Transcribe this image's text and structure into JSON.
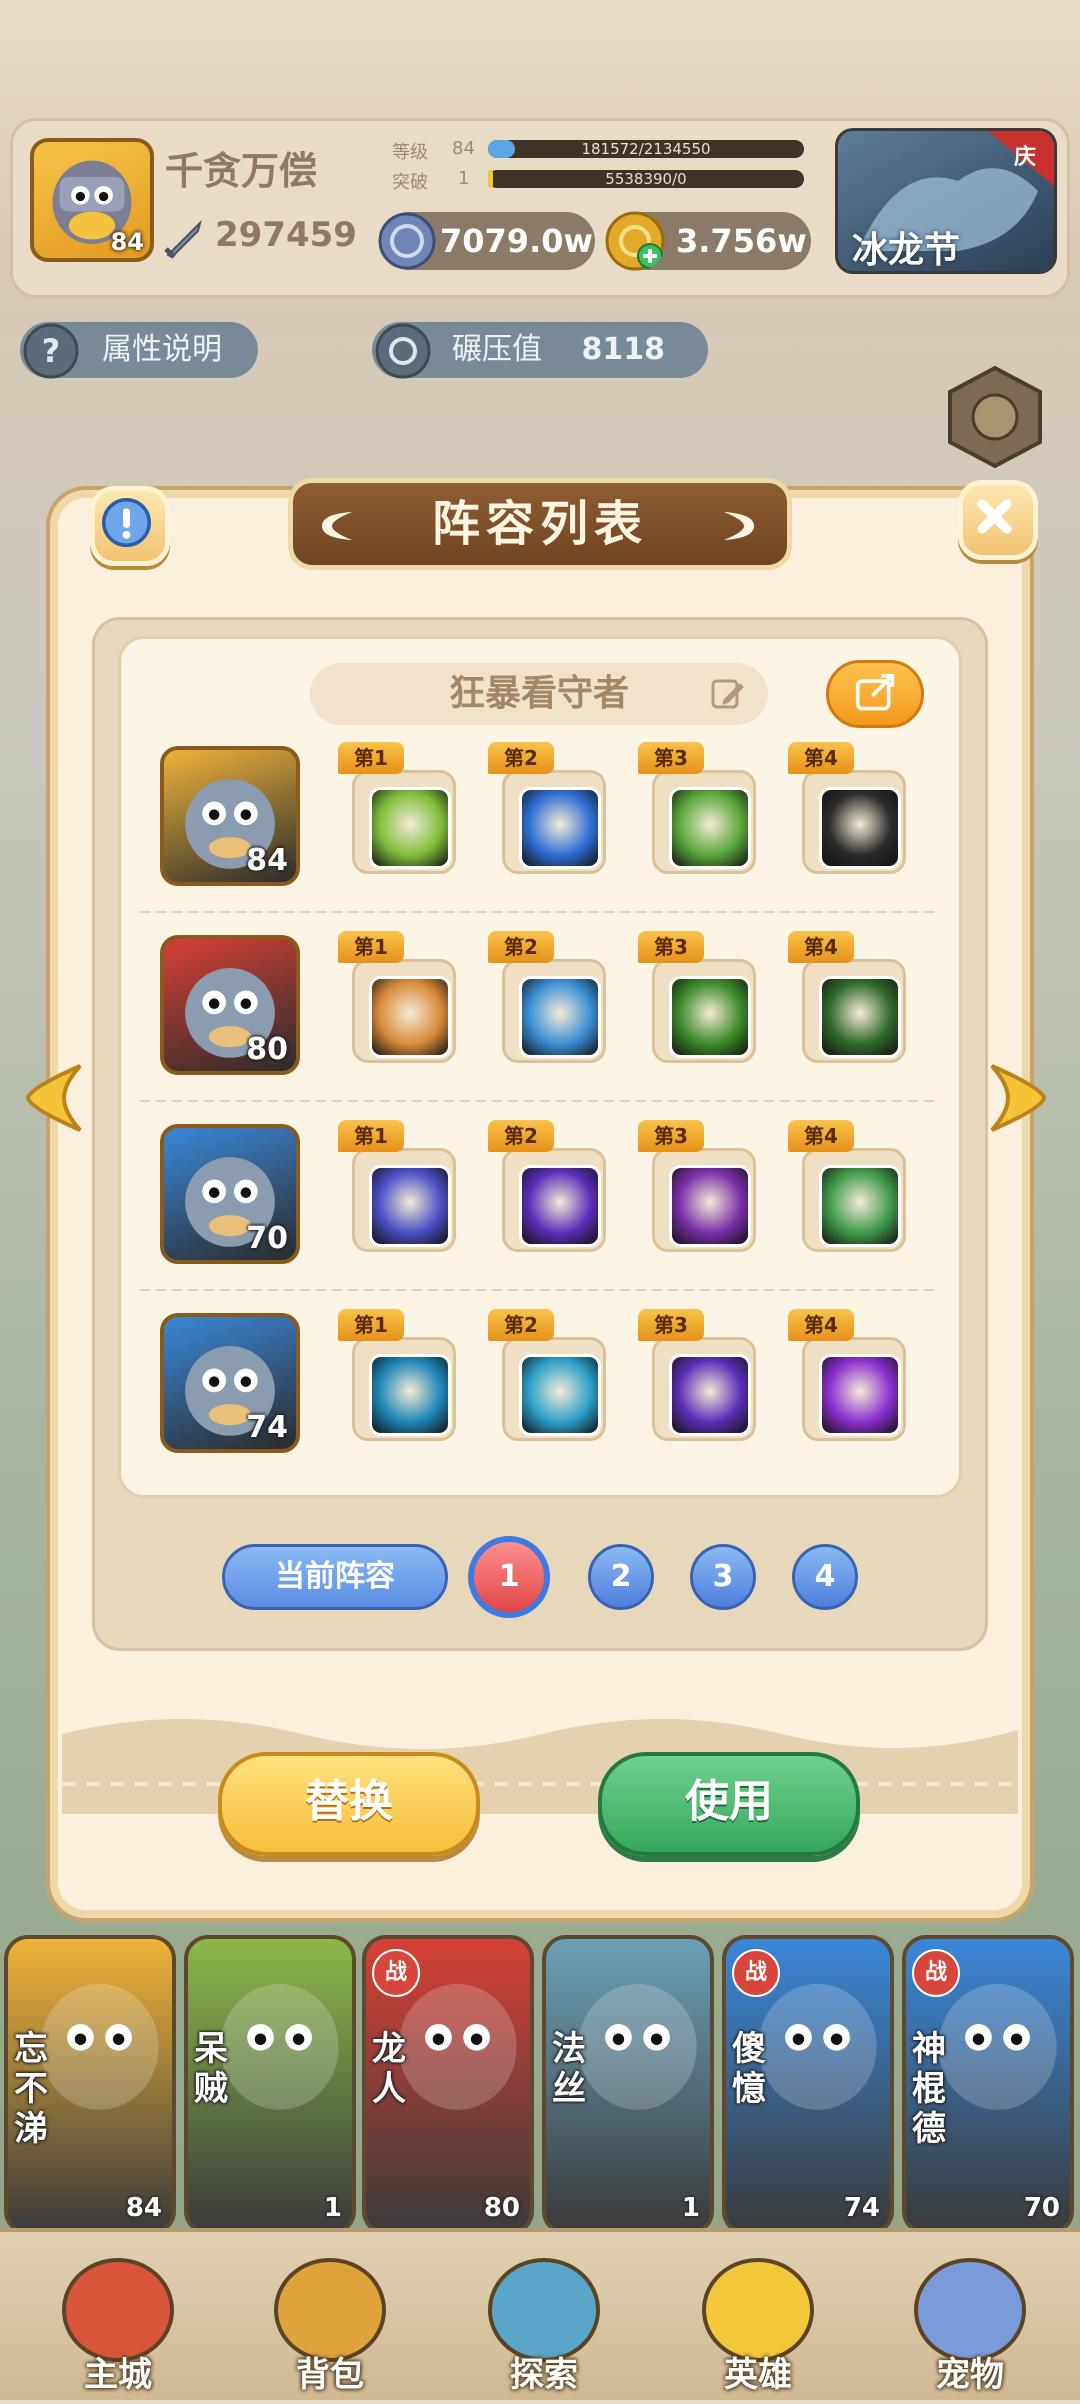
{
  "player": {
    "name": "千贪万偿",
    "avatar_level": "84",
    "power": "297459",
    "level_label": "等级",
    "level_value": "84",
    "exp_text": "181572/2134550",
    "exp_progress": 0.085,
    "break_label": "突破",
    "break_value": "1",
    "break_text": "5538390/0",
    "break_progress": 0.0
  },
  "currency": {
    "silver": "7079.0w",
    "gold": "3.756w"
  },
  "event": {
    "label": "冰龙节",
    "corner_tag": "庆"
  },
  "info_buttons": {
    "attr": "属性说明",
    "crush_label": "碾压值",
    "crush_value": "8118"
  },
  "modal": {
    "title": "阵容列表",
    "team_name": "狂暴看守者",
    "rows": [
      {
        "hero_level": "84",
        "hero_color": "#f0b33a",
        "skills": [
          {
            "tag": "第1",
            "color": "#7fbf3a"
          },
          {
            "tag": "第2",
            "color": "#2f6fd6"
          },
          {
            "tag": "第3",
            "color": "#5aa83a"
          },
          {
            "tag": "第4",
            "color": "#2b2b2b"
          }
        ]
      },
      {
        "hero_level": "80",
        "hero_color": "#d64035",
        "skills": [
          {
            "tag": "第1",
            "color": "#d98b3a"
          },
          {
            "tag": "第2",
            "color": "#3a8fd6"
          },
          {
            "tag": "第3",
            "color": "#3c8a2a"
          },
          {
            "tag": "第4",
            "color": "#2f6a2a"
          }
        ]
      },
      {
        "hero_level": "70",
        "hero_color": "#3a87d9",
        "skills": [
          {
            "tag": "第1",
            "color": "#4a4fc4"
          },
          {
            "tag": "第2",
            "color": "#5a2fb8"
          },
          {
            "tag": "第3",
            "color": "#7a2fa8"
          },
          {
            "tag": "第4",
            "color": "#3f9a4a"
          }
        ]
      },
      {
        "hero_level": "74",
        "hero_color": "#3a87d9",
        "skills": [
          {
            "tag": "第1",
            "color": "#1f86b8"
          },
          {
            "tag": "第2",
            "color": "#2ca0c9"
          },
          {
            "tag": "第3",
            "color": "#5a2fb8"
          },
          {
            "tag": "第4",
            "color": "#8a2fd0"
          }
        ]
      }
    ],
    "current_lineup": "当前阵容",
    "pages": [
      "1",
      "2",
      "3",
      "4"
    ],
    "active_page": 0,
    "replace_btn": "替换",
    "use_btn": "使用"
  },
  "roster": [
    {
      "name": "忘不涕",
      "level": "84",
      "color": "#f0b33a",
      "badge": ""
    },
    {
      "name": "呆贼",
      "level": "1",
      "color": "#8bb84a",
      "badge": ""
    },
    {
      "name": "龙人",
      "level": "80",
      "color": "#d64035",
      "badge": "战"
    },
    {
      "name": "法丝",
      "level": "1",
      "color": "#6aa0b8",
      "badge": ""
    },
    {
      "name": "傻憶",
      "level": "74",
      "color": "#3a87d9",
      "badge": "战"
    },
    {
      "name": "神棍德",
      "level": "70",
      "color": "#3a87d9",
      "badge": "战"
    }
  ],
  "nav": [
    "主城",
    "背包",
    "探索",
    "英雄",
    "宠物"
  ],
  "icons": [
    "info-icon",
    "close-icon",
    "edit-icon",
    "share-icon",
    "question-icon",
    "sword-icon",
    "silver-coin-icon",
    "gold-coin-icon",
    "arrow-left-icon",
    "arrow-right-icon"
  ]
}
